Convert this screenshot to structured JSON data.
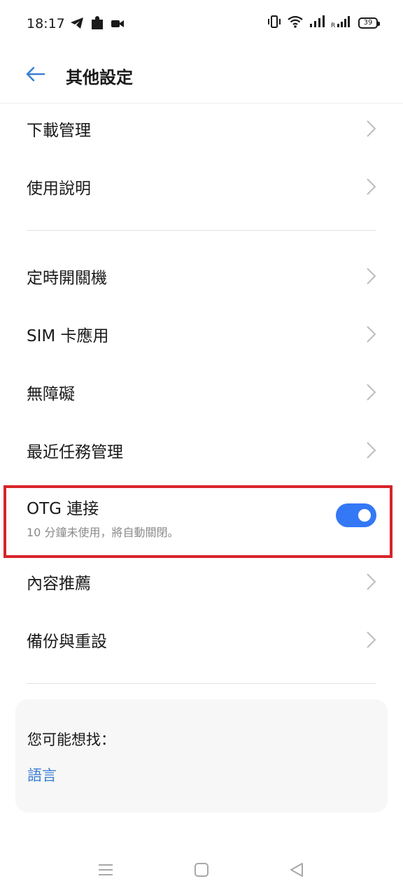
{
  "status_bar": {
    "time": "18:17",
    "battery": "39",
    "left_icons": [
      "telegram-icon",
      "puzzle-icon",
      "video-recorder-icon"
    ],
    "right_icons": [
      "vibrate-icon",
      "wifi-icon",
      "signal-icon",
      "roaming-signal-icon",
      "battery-icon"
    ]
  },
  "header": {
    "title": "其他設定",
    "back_icon": "back-arrow-icon"
  },
  "settings": {
    "group1": [
      {
        "label": "下載管理"
      },
      {
        "label": "使用說明"
      }
    ],
    "group2": [
      {
        "label": "定時開關機"
      },
      {
        "label": "SIM 卡應用"
      },
      {
        "label": "無障礙"
      },
      {
        "label": "最近任務管理"
      }
    ],
    "otg": {
      "title": "OTG 連接",
      "subtitle": "10 分鐘未使用，將自動關閉。",
      "enabled": true
    },
    "group3": [
      {
        "label": "內容推薦"
      },
      {
        "label": "備份與重設"
      }
    ]
  },
  "suggestions": {
    "title": "您可能想找：",
    "link": "語言"
  },
  "colors": {
    "accent": "#3478f6",
    "link": "#3a7fd5",
    "highlight": "#d8232a"
  },
  "nav_bar": [
    "menu-icon",
    "home-icon",
    "back-triangle-icon"
  ]
}
